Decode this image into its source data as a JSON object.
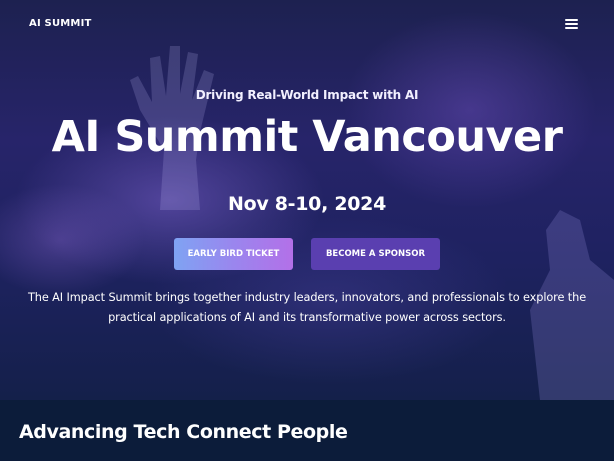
{
  "nav": {
    "logo": "AI SUMMIT",
    "menu_icon": "hamburger-menu-icon"
  },
  "hero": {
    "tagline": "Driving Real-World Impact with AI",
    "title": "AI Summit Vancouver",
    "date": "Nov 8-10, 2024",
    "buttons": {
      "early_bird": "EARLY BIRD TICKET",
      "sponsor": "BECOME A SPONSOR"
    },
    "description": "The AI Impact Summit brings together industry leaders, innovators, and professionals to explore the practical applications of AI and its transformative power across sectors."
  },
  "section": {
    "title": "Advancing Tech Connect People"
  },
  "colors": {
    "hero_top": "#1d2150",
    "hero_mid": "#27246a",
    "section_bg": "#0c1c3a",
    "early_bird_gradient_start": "#7fa3f3",
    "early_bird_gradient_end": "#b370e8",
    "sponsor_button": "#5a3fb0"
  }
}
